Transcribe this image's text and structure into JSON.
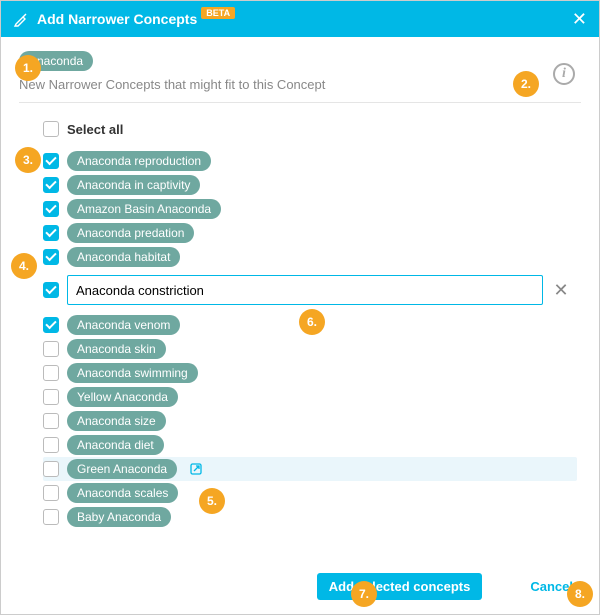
{
  "header": {
    "title": "Add Narrower Concepts",
    "beta": "BETA"
  },
  "intro": {
    "concept": "Anaconda",
    "desc": "New Narrower Concepts that might fit to this Concept",
    "info_glyph": "i"
  },
  "select_all_label": "Select all",
  "edit_value": "Anaconda constriction",
  "items": [
    {
      "label": "Anaconda reproduction",
      "checked": true
    },
    {
      "label": "Anaconda in captivity",
      "checked": true
    },
    {
      "label": "Amazon Basin Anaconda",
      "checked": true
    },
    {
      "label": "Anaconda predation",
      "checked": true
    },
    {
      "label": "Anaconda habitat",
      "checked": true
    }
  ],
  "items2": [
    {
      "label": "Anaconda venom",
      "checked": true
    },
    {
      "label": "Anaconda skin",
      "checked": false
    },
    {
      "label": "Anaconda swimming",
      "checked": false
    },
    {
      "label": "Yellow Anaconda",
      "checked": false
    },
    {
      "label": "Anaconda size",
      "checked": false
    },
    {
      "label": "Anaconda diet",
      "checked": false
    },
    {
      "label": "Green Anaconda",
      "checked": false,
      "highlight": true,
      "ext": true
    },
    {
      "label": "Anaconda scales",
      "checked": false
    },
    {
      "label": "Baby Anaconda",
      "checked": false
    }
  ],
  "footer": {
    "primary": "Add selected concepts",
    "cancel": "Cancel"
  },
  "annotations": [
    "1.",
    "2.",
    "3.",
    "4.",
    "5.",
    "6.",
    "7.",
    "8."
  ]
}
